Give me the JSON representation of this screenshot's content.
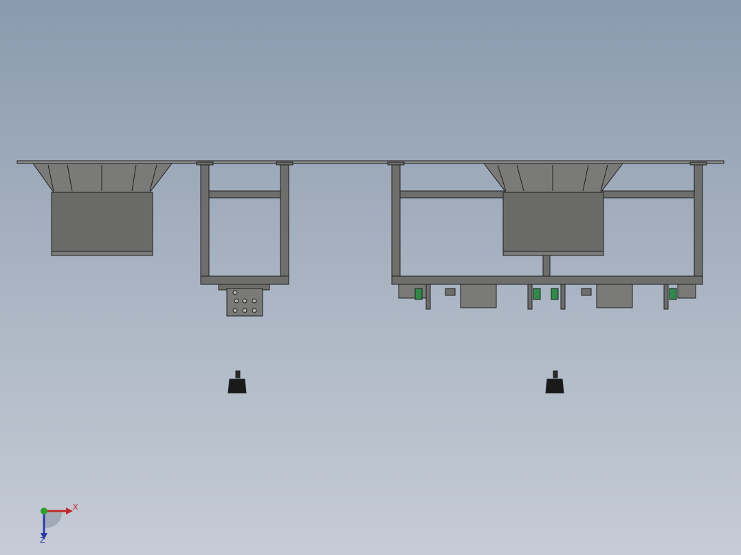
{
  "viewport": {
    "background_top": "#8a9aae",
    "background_bottom": "#c6ccd6",
    "model_fill": "#6e6e6c",
    "model_fill_light": "#8a8a88",
    "model_edge": "#1e1e1e",
    "accent_green": "#2f8a4a"
  },
  "triad": {
    "x_label": "X",
    "z_label": "Z",
    "x_color": "#c0282a",
    "y_color": "#2aa02a",
    "z_color": "#2a3aa8"
  },
  "icons": {
    "triad": "coordinate-triad-icon"
  }
}
